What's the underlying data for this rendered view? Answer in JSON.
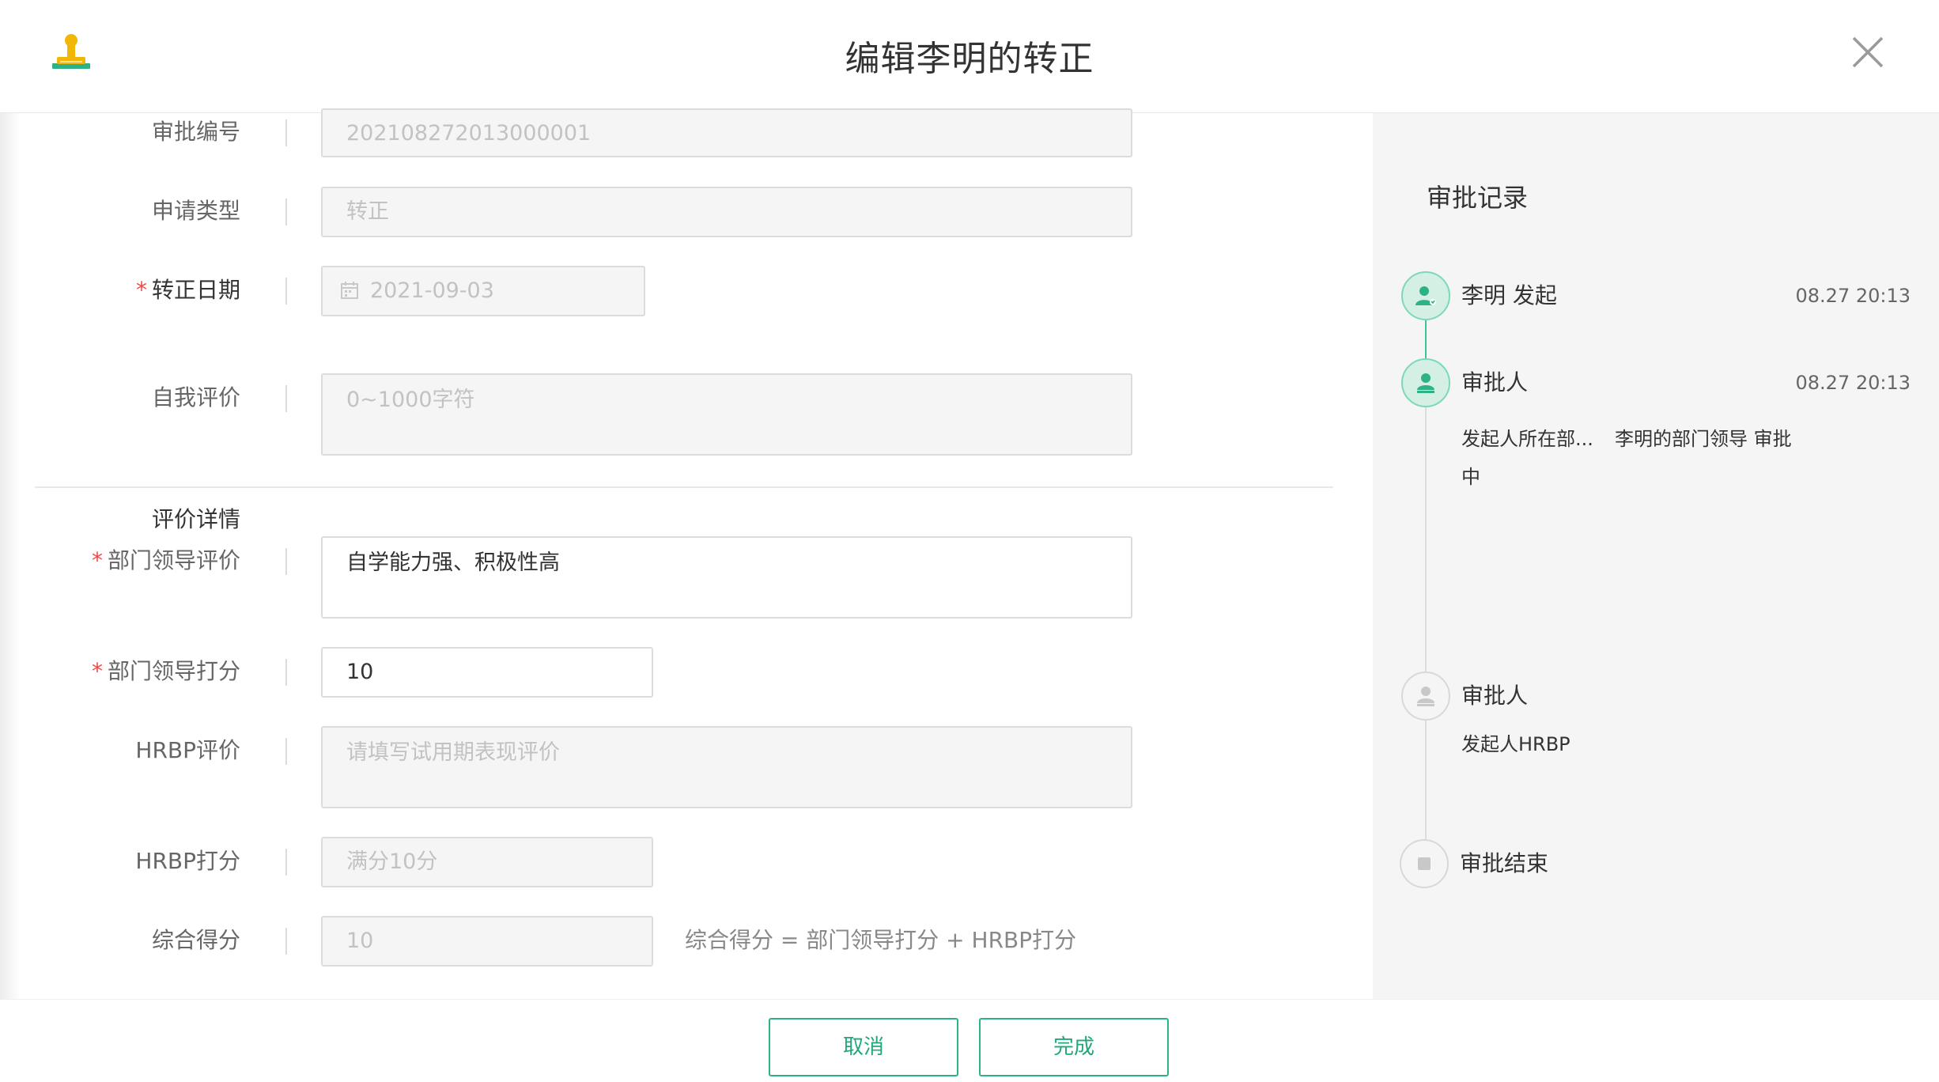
{
  "header": {
    "title": "编辑李明的转正"
  },
  "form": {
    "approval_no": {
      "label": "审批编号",
      "value": "202108272013000001"
    },
    "apply_type": {
      "label": "申请类型",
      "value": "转正"
    },
    "confirm_date": {
      "label": "转正日期",
      "required": "*",
      "value": "2021-09-03"
    },
    "self_eval": {
      "label": "自我评价",
      "placeholder": "0~1000字符"
    },
    "section_title": "评价详情",
    "leader_eval": {
      "label": "部门领导评价",
      "required": "*",
      "value": "自学能力强、积极性高"
    },
    "leader_score": {
      "label": "部门领导打分",
      "required": "*",
      "value": "10"
    },
    "hrbp_eval": {
      "label": "HRBP评价",
      "placeholder": "请填写试用期表现评价"
    },
    "hrbp_score": {
      "label": "HRBP打分",
      "placeholder": "满分10分"
    },
    "total_score": {
      "label": "综合得分",
      "value": "10",
      "formula": "综合得分 = 部门领导打分 + HRBP打分"
    }
  },
  "approval_record": {
    "title": "审批记录",
    "nodes": [
      {
        "name": "李明 发起",
        "time": "08.27 20:13",
        "status": "done"
      },
      {
        "name": "审批人",
        "time": "08.27 20:13",
        "status": "active",
        "sub_left": "发起人所在部...",
        "sub_right": "李明的部门领导 审批",
        "sub_line2": "中"
      },
      {
        "name": "审批人",
        "status": "pending",
        "sub_left": "发起人HRBP"
      },
      {
        "name": "审批结束",
        "status": "end"
      }
    ]
  },
  "footer": {
    "cancel_label": "取消",
    "done_label": "完成"
  },
  "colors": {
    "accent": "#2eb285",
    "required": "#f04848",
    "panel_bg": "#f5f5f5"
  },
  "icons": {
    "app": "stamp-icon",
    "close": "close-icon",
    "calendar": "calendar-icon",
    "initiator": "user-icon",
    "approver": "stamp-user-icon",
    "end": "stop-icon"
  }
}
